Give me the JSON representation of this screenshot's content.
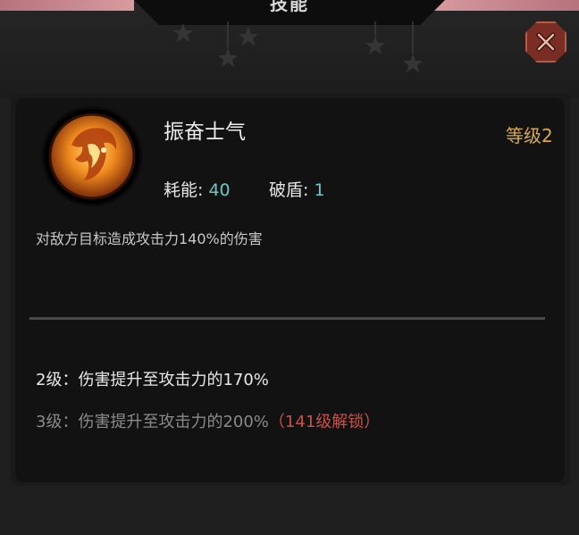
{
  "header": {
    "title": "技能"
  },
  "skill": {
    "name": "振奋士气",
    "level_text": "等级2",
    "energy_label": "耗能:",
    "energy_value": "40",
    "break_label": "破盾:",
    "break_value": "1",
    "description": "对敌方目标造成攻击力140%的伤害",
    "icon": "flame-horse-icon"
  },
  "upgrades": [
    {
      "label": "2级：伤害提升至攻击力的170%",
      "unlock_note": ""
    },
    {
      "label": "3级：伤害提升至攻击力的200%",
      "unlock_note": "（141级解锁）"
    }
  ],
  "colors": {
    "accent_level": "#d9aa55",
    "stat_value": "#6fc6c6",
    "lock_red": "#c7514a",
    "close_bg": "#7a2d23"
  }
}
